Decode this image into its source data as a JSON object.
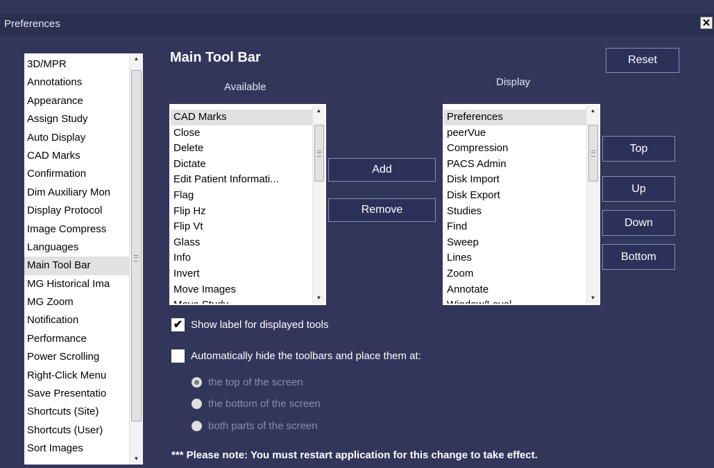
{
  "window": {
    "title": "Preferences",
    "close_label": "✕"
  },
  "categories": {
    "items": [
      "3D/MPR",
      "Annotations",
      "Appearance",
      "Assign Study",
      "Auto Display",
      "CAD Marks",
      "Confirmation",
      "Dim Auxiliary Mon",
      "Display Protocol",
      "Image Compress",
      "Languages",
      "Main Tool Bar",
      "MG Historical Ima",
      "MG Zoom",
      "Notification",
      "Performance",
      "Power Scrolling",
      "Right-Click Menu",
      "Save Presentatio",
      "Shortcuts (Site)",
      "Shortcuts (User)",
      "Sort Images"
    ],
    "selected": "Main Tool Bar"
  },
  "main": {
    "heading": "Main Tool Bar",
    "reset_label": "Reset",
    "available_label": "Available",
    "display_label": "Display",
    "available_items": [
      "CAD Marks",
      "Close",
      "Delete",
      "Dictate",
      "Edit Patient Informati...",
      "Flag",
      "Flip Hz",
      "Flip Vt",
      "Glass",
      "Info",
      "Invert",
      "Move Images",
      "Move Study"
    ],
    "display_items": [
      "Preferences",
      "peerVue",
      "Compression",
      "PACS Admin",
      "Disk Import",
      "Disk Export",
      "Studies",
      "Find",
      "Sweep",
      "Lines",
      "Zoom",
      "Annotate",
      "Window/Level"
    ],
    "add_label": "Add",
    "remove_label": "Remove",
    "top_label": "Top",
    "up_label": "Up",
    "down_label": "Down",
    "bottom_label": "Bottom"
  },
  "options": {
    "show_label_text": "Show label for displayed tools",
    "show_label_checked": true,
    "auto_hide_text": "Automatically hide the toolbars and place them at:",
    "auto_hide_checked": false,
    "positions": [
      "the top of the screen",
      "the bottom  of the screen",
      "both parts of the screen"
    ],
    "selected_position": 0
  },
  "note": "*** Please note: You must restart application for this change to take effect."
}
